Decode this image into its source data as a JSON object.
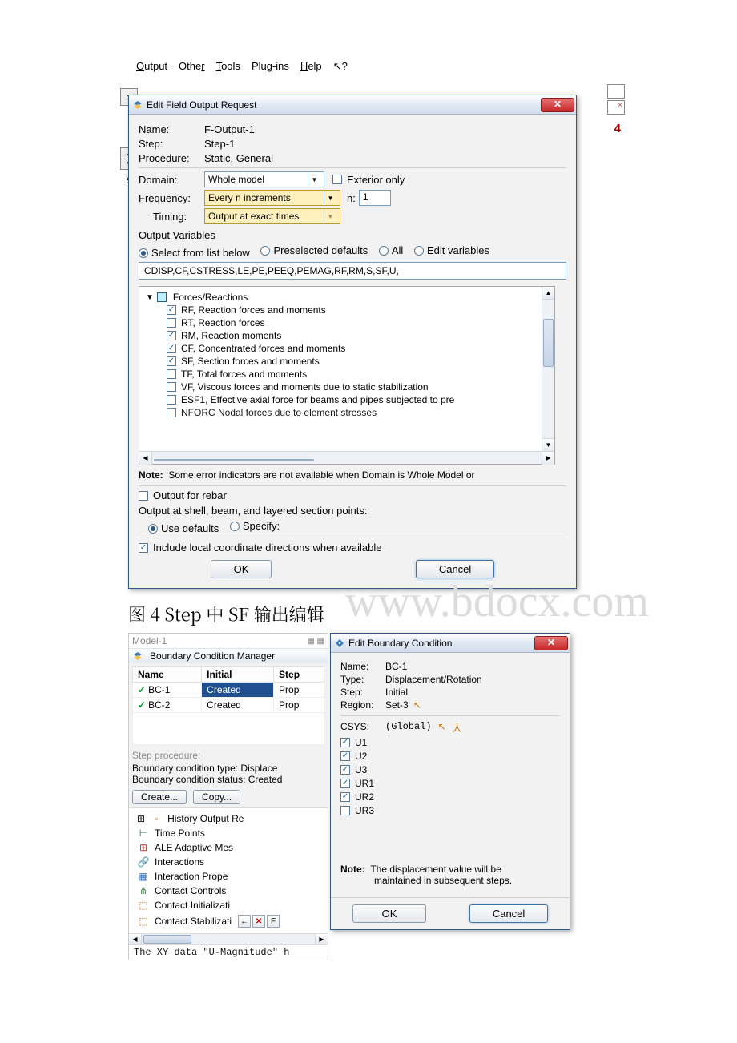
{
  "menubar": {
    "output": "Output",
    "other": "Other",
    "tools": "Tools",
    "plugins": "Plug-ins",
    "help": "Help",
    "whatsthis": "↖?"
  },
  "dialog1": {
    "title": "Edit Field Output Request",
    "name_label": "Name:",
    "name_value": "F-Output-1",
    "step_label": "Step:",
    "step_value": "Step-1",
    "procedure_label": "Procedure:",
    "procedure_value": "Static, General",
    "domain_label": "Domain:",
    "domain_value": "Whole model",
    "exterior_only": "Exterior only",
    "frequency_label": "Frequency:",
    "frequency_value": "Every n increments",
    "n_label": "n:",
    "n_value": "1",
    "timing_label": "Timing:",
    "timing_value": "Output at exact times",
    "ov_title": "Output Variables",
    "radio_select": "Select from list below",
    "radio_preselected": "Preselected defaults",
    "radio_all": "All",
    "radio_edit": "Edit variables",
    "var_string": "CDISP,CF,CSTRESS,LE,PE,PEEQ,PEMAG,RF,RM,S,SF,U,",
    "tree_header": "Forces/Reactions",
    "items": {
      "rf": "RF, Reaction forces and moments",
      "rt": "RT, Reaction forces",
      "rm": "RM, Reaction moments",
      "cf": "CF, Concentrated forces and moments",
      "sf": "SF, Section forces and moments",
      "tf": "TF, Total forces and moments",
      "vf": "VF, Viscous forces and moments due to static stabilization",
      "esf1": "ESF1, Effective axial force for beams and pipes subjected to pre",
      "nforc": "NFORC  Nodal forces due to element stresses"
    },
    "note": "Some error indicators are not available when Domain is Whole Model or",
    "note_prefix": "Note:",
    "output_rebar": "Output for rebar",
    "shell_line": "Output at shell, beam, and layered section points:",
    "use_defaults": "Use defaults",
    "specify": "Specify:",
    "include_local": "Include local coordinate directions when available",
    "ok": "OK",
    "cancel": "Cancel"
  },
  "caption": "图 4 Step 中 SF 输出编辑",
  "watermark": "www.bdocx.com",
  "left_side": {
    "spin_letter": "S",
    "big4": "4"
  },
  "tree_top": "Model-1",
  "bcm": {
    "title": "Boundary Condition Manager",
    "col_name": "Name",
    "col_initial": "Initial",
    "col_step": "Step",
    "rows": [
      {
        "name": "BC-1",
        "initial": "Created",
        "step": "Prop"
      },
      {
        "name": "BC-2",
        "initial": "Created",
        "step": "Prop"
      }
    ],
    "step_procedure": "Step procedure:",
    "bctype_line": "Boundary condition type:   Displace",
    "bcstat_line": "Boundary condition status: Created",
    "create": "Create...",
    "copy": "Copy..."
  },
  "model_tree": {
    "history": "History Output Re",
    "time_points": "Time Points",
    "ale": "ALE Adaptive Mes",
    "interactions": "Interactions",
    "int_prop": "Interaction Prope",
    "contact_ctrl": "Contact Controls",
    "contact_init": "Contact Initializati",
    "contact_stab": "Contact Stabilizati"
  },
  "console": "The XY data \"U-Magnitude\" h",
  "ebc": {
    "title": "Edit Boundary Condition",
    "name_label": "Name:",
    "name_value": "BC-1",
    "type_label": "Type:",
    "type_value": "Displacement/Rotation",
    "step_label": "Step:",
    "step_value": "Initial",
    "region_label": "Region:",
    "region_value": "Set-3",
    "csys_label": "CSYS:",
    "csys_value": "(Global)",
    "u1": "U1",
    "u2": "U2",
    "u3": "U3",
    "ur1": "UR1",
    "ur2": "UR2",
    "ur3": "UR3",
    "note_prefix": "Note:",
    "note1": "The displacement value will be",
    "note2": "maintained in subsequent steps.",
    "ok": "OK",
    "cancel": "Cancel"
  }
}
